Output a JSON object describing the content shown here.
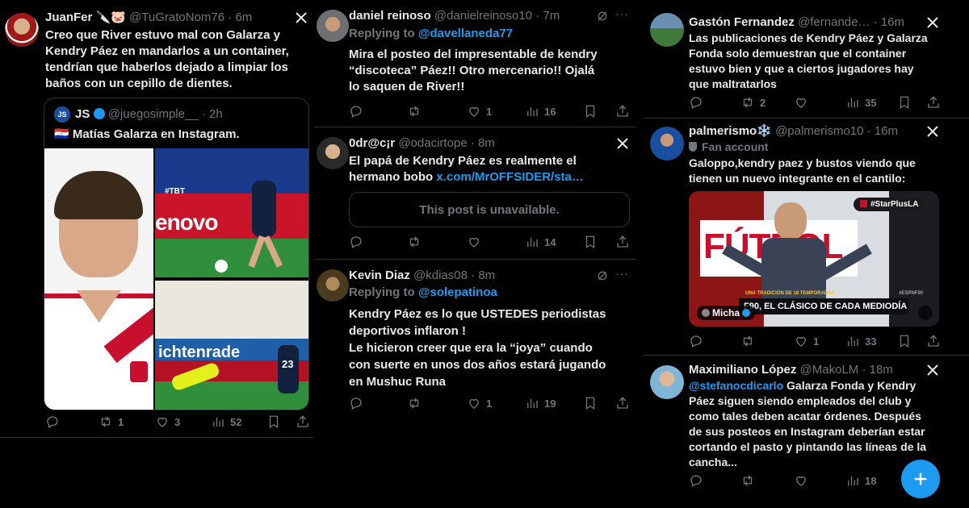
{
  "col1": {
    "tweet": {
      "name": "JuanFer 🔪🐷",
      "handle": "@TuGratoNom76",
      "time": "6m",
      "text_lines": [
        "Creo que River estuvo mal con Galarza y",
        "Kendry Páez en mandarlos a un container,",
        "tendrían que haberlos dejado a limpiar los",
        "baños con un cepillo de dientes."
      ],
      "quote": {
        "name": "JS",
        "handle": "@juegosimple__",
        "time": "2h",
        "text": "🇵🇾 Matías Galarza en Instagram.",
        "img_text_tbt": "#TBT",
        "img_text_brand": "enovo",
        "img_text_banner": "ichtenrade",
        "jersey_number": "23"
      },
      "replies": "",
      "retweets": "1",
      "likes": "3",
      "views": "52"
    }
  },
  "col2": {
    "tweets": [
      {
        "name": "daniel reinoso",
        "handle": "@danielreinoso10",
        "time": "7m",
        "replying_label": "Replying to",
        "replying_to": "@davellaneda77",
        "text_lines": [
          "Mira el posteo del impresentable de kendry",
          "“discoteca” Páez!! Otro mercenario!! Ojalá",
          "lo saquen de River!!"
        ],
        "replies": "",
        "retweets": "",
        "likes": "1",
        "views": "16"
      },
      {
        "name": "0dr@c¡r",
        "handle": "@odacirtope",
        "time": "8m",
        "text_lines": [
          "El papá de Kendry Páez es realmente el",
          "hermano bobo"
        ],
        "link": "x.com/MrOFFSIDER/sta…",
        "unavailable": "This post is unavailable.",
        "replies": "",
        "retweets": "",
        "likes": "",
        "views": "14"
      },
      {
        "name": "Kevin Diaz",
        "handle": "@kdias08",
        "time": "8m",
        "replying_label": "Replying to",
        "replying_to": "@solepatinoa",
        "text_lines": [
          "Kendry Páez es lo que USTEDES periodistas",
          "deportivos inflaron !",
          "Le hicieron creer que era la “joya” cuando",
          "con suerte en unos dos años estará jugando",
          "en Mushuc Runa"
        ],
        "replies": "",
        "retweets": "",
        "likes": "1",
        "views": "19"
      }
    ]
  },
  "col3": {
    "tweets": [
      {
        "name": "Gastón Fernandez",
        "handle": "@fernande…",
        "time": "16m",
        "text_lines": [
          "Las publicaciones de Kendry Páez y Galarza",
          "Fonda solo demuestran que el container",
          "estuvo bien y que a ciertos jugadores hay",
          "que maltratarlos"
        ],
        "replies": "",
        "retweets": "2",
        "likes": "",
        "views": "35"
      },
      {
        "name": "palmerismo❄️",
        "handle": "@palmerismo10",
        "time": "16m",
        "fan_label": "Fan account",
        "text_lines": [
          "Galoppo,kendry paez y bustos viendo que",
          "tienen un nuevo integrante en el cantilo:"
        ],
        "media": {
          "tag": "#StarPlusLA",
          "show": "FÚTBOL",
          "ticker_small": "UNA TRADICIÓN DE 18 TEMPORADAS",
          "ticker": "F90, EL CLÁSICO DE CADA MEDIODÍA",
          "user": "Micha",
          "channel": "#ESPNF90"
        },
        "replies": "",
        "retweets": "",
        "likes": "1",
        "views": "33"
      },
      {
        "name": "Maximiliano López",
        "handle": "@MakoLM",
        "time": "18m",
        "mention": "@stefanocdicarlo",
        "text_first": " Galarza Fonda y Kendry",
        "text_lines": [
          "Páez siguen siendo empleados del club y",
          "como tales deben acatar órdenes. Después",
          "de sus posteos en Instagram deberían estar",
          "cortando el pasto y pintando las líneas de la",
          "cancha..."
        ],
        "replies": "",
        "retweets": "",
        "likes": "",
        "views": "18"
      }
    ]
  },
  "colors": {
    "accent": "#1d9bf0",
    "muted": "#71767b",
    "text": "#e7e9ea",
    "divider": "#2f3336"
  },
  "icons": [
    "x-logo-icon",
    "reply-icon",
    "retweet-icon",
    "like-icon",
    "views-icon",
    "bookmark-icon",
    "share-icon",
    "grok-icon",
    "more-icon",
    "verified-icon",
    "plus-icon"
  ]
}
